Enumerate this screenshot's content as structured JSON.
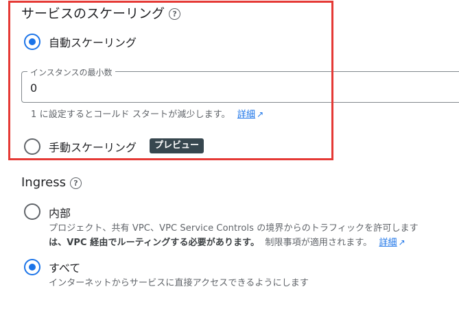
{
  "scaling": {
    "title": "サービスのスケーリング",
    "help_icon": "?",
    "auto": {
      "label": "自動スケーリング",
      "selected": true
    },
    "min_instances": {
      "label": "インスタンスの最小数",
      "value": "0",
      "hint": "1 に設定するとコールド スタートが減少します。",
      "link": "詳細"
    },
    "manual": {
      "label": "手動スケーリング",
      "badge": "プレビュー",
      "selected": false
    }
  },
  "ingress": {
    "title": "Ingress",
    "help_icon": "?",
    "internal": {
      "label": "内部",
      "desc_line1": "プロジェクト、共有 VPC、VPC Service Controls の境界からのトラフィックを許可します",
      "desc_line2_bold": "は、VPC 経由でルーティングする必要があります。",
      "desc_line2_rest": "制限事項が適用されます。",
      "link": "詳細",
      "selected": false
    },
    "all": {
      "label": "すべて",
      "desc": "インターネットからサービスに直接アクセスできるようにします",
      "selected": true
    }
  },
  "colors": {
    "accent": "#1a73e8",
    "highlight_border": "#e53935",
    "badge_bg": "#37474f"
  },
  "icons": {
    "help": "help-circle-icon",
    "external": "open-in-new-icon"
  }
}
